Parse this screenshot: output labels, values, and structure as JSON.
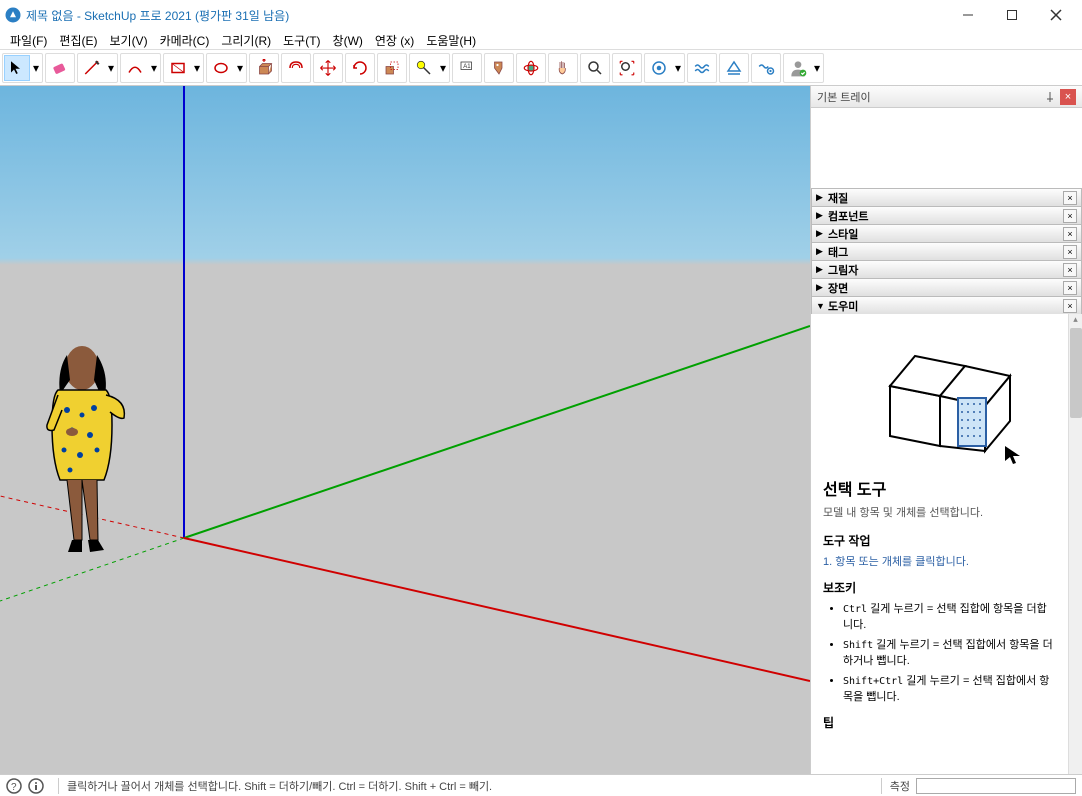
{
  "titlebar": {
    "title": "제목 없음 - SketchUp 프로 2021 (평가판 31일 남음)"
  },
  "menu": {
    "file": "파일(F)",
    "edit": "편집(E)",
    "view": "보기(V)",
    "camera": "카메라(C)",
    "draw": "그리기(R)",
    "tools": "도구(T)",
    "window": "창(W)",
    "extensions": "연장 (x)",
    "help": "도움말(H)"
  },
  "tray": {
    "title": "기본 트레이",
    "panels": {
      "materials": "재질",
      "components": "컴포넌트",
      "styles": "스타일",
      "tags": "태그",
      "shadows": "그림자",
      "scenes": "장면",
      "instructor": "도우미"
    }
  },
  "instructor": {
    "title": "선택 도구",
    "desc": "모델 내 항목 및 개체를 선택합니다.",
    "tool_op_heading": "도구 작업",
    "step1": "1. 항목 또는 개체를 클릭합니다.",
    "modkeys_heading": "보조키",
    "mod1_key": "Ctrl",
    "mod1_text": " 길게 누르기 = 선택 집합에 항목을 더합니다.",
    "mod2_key": "Shift",
    "mod2_text": " 길게 누르기 = 선택 집합에서 항목을 더하거나 뺍니다.",
    "mod3_key": "Shift+Ctrl",
    "mod3_text": " 길게 누르기 = 선택 집합에서 항목을 뺍니다.",
    "tips_heading": "팁"
  },
  "statusbar": {
    "hint": "클릭하거나 끌어서 개체를 선택합니다. Shift = 더하기/빼기. Ctrl = 더하기. Shift + Ctrl = 빼기.",
    "measure_label": "측정"
  }
}
